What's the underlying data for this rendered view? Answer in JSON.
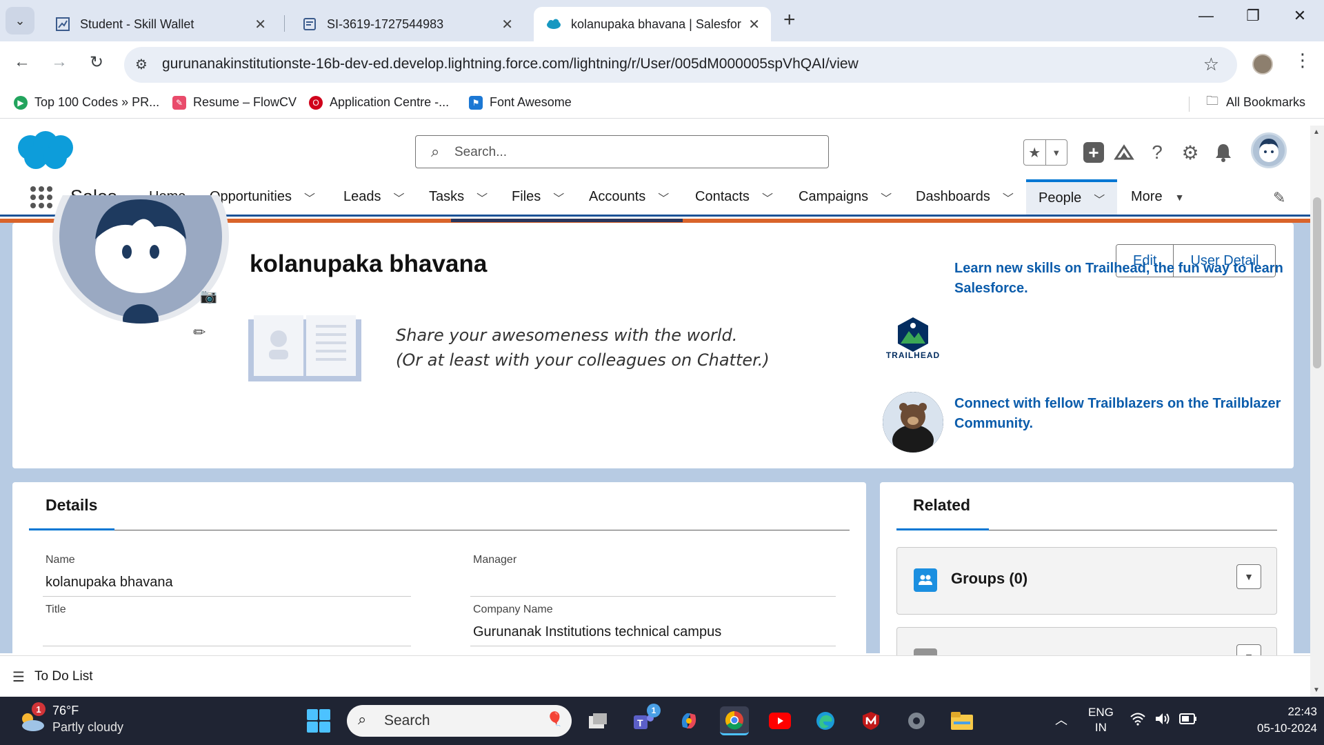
{
  "browser": {
    "tabs": [
      {
        "label": "Student - Skill Wallet",
        "icon": "chart-icon"
      },
      {
        "label": "SI-3619-1727544983",
        "icon": "document-icon"
      },
      {
        "label": "kolanupaka bhavana | Salesforc",
        "icon": "salesforce-cloud-icon"
      }
    ],
    "url": "gurunanakinstitutionste-16b-dev-ed.develop.lightning.force.com/lightning/r/User/005dM000005spVhQAI/view",
    "bookmarks": [
      {
        "label": "Top 100 Codes » PR...",
        "icon": "shield-icon",
        "color": "#22a45d"
      },
      {
        "label": "Resume – FlowCV",
        "icon": "pen-icon",
        "color": "#e94b6b"
      },
      {
        "label": "Application Centre -...",
        "icon": "opera-icon",
        "color": "#d0021b"
      },
      {
        "label": "Font Awesome",
        "icon": "flag-icon",
        "color": "#1c78d4"
      }
    ],
    "all_bookmarks": "All Bookmarks"
  },
  "sf": {
    "search_placeholder": "Search...",
    "app_name": "Sales",
    "nav": [
      {
        "label": "Home",
        "chevron": false
      },
      {
        "label": "Opportunities",
        "chevron": true
      },
      {
        "label": "Leads",
        "chevron": true
      },
      {
        "label": "Tasks",
        "chevron": true
      },
      {
        "label": "Files",
        "chevron": true
      },
      {
        "label": "Accounts",
        "chevron": true
      },
      {
        "label": "Contacts",
        "chevron": true
      },
      {
        "label": "Campaigns",
        "chevron": true
      },
      {
        "label": "Dashboards",
        "chevron": true
      },
      {
        "label": "People",
        "chevron": true
      },
      {
        "label": "More",
        "chevron": true
      }
    ],
    "active_nav": "People",
    "brand_color": "#0176d3"
  },
  "profile": {
    "name": "kolanupaka bhavana",
    "edit_label": "Edit",
    "user_detail_label": "User Detail",
    "chatter_line1": "Share your awesomeness with the world.",
    "chatter_line2": "(Or at least with your colleagues on Chatter.)",
    "trailhead_label": "TRAILHEAD",
    "promo1": "Learn new skills on Trailhead, the fun way to learn Salesforce.",
    "promo2": "Connect with fellow Trailblazers on the Trailblazer Community."
  },
  "details": {
    "tab": "Details",
    "name_label": "Name",
    "name_value": "kolanupaka bhavana",
    "manager_label": "Manager",
    "manager_value": "",
    "title_label": "Title",
    "title_value": "",
    "company_label": "Company Name",
    "company_value": "Gurunanak Institutions technical campus"
  },
  "related": {
    "tab": "Related",
    "groups_label": "Groups (0)"
  },
  "todo": "To Do List",
  "taskbar": {
    "weather_badge": "1",
    "temperature": "76°F",
    "condition": "Partly cloudy",
    "search": "Search",
    "teams_badge": "1",
    "lang1": "ENG",
    "lang2": "IN",
    "time": "22:43",
    "date": "05-10-2024"
  }
}
